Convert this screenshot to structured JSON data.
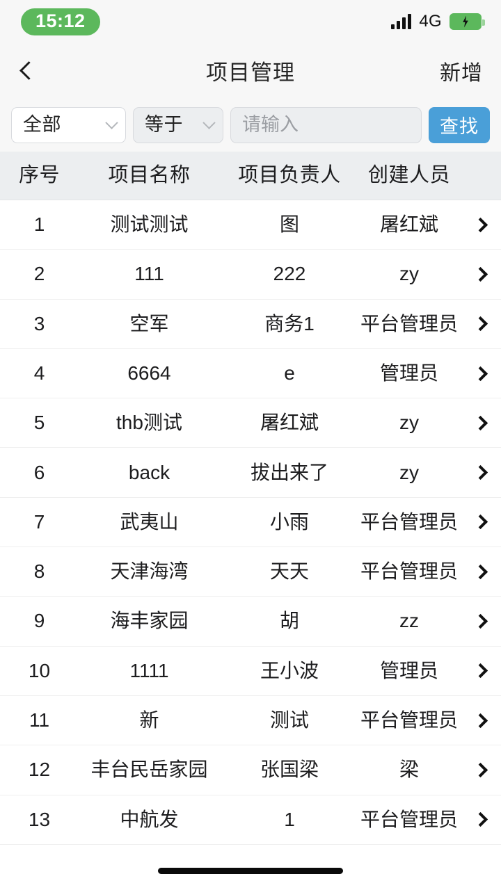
{
  "status_bar": {
    "time": "15:12",
    "network_label": "4G",
    "signal_icon": "signal-bars-icon",
    "battery_icon": "battery-charging-icon",
    "battery_color": "#5cb85c",
    "time_pill_color": "#5cb85c"
  },
  "nav_bar": {
    "back_icon": "chevron-left-icon",
    "title": "项目管理",
    "action_label": "新增"
  },
  "filter_bar": {
    "field_select": {
      "value": "全部",
      "icon": "chevron-down-icon"
    },
    "operator_select": {
      "value": "等于",
      "icon": "chevron-down-icon"
    },
    "keyword_input": {
      "value": "",
      "placeholder": "请输入"
    },
    "search_button": {
      "label": "查找",
      "color": "#4a9fd8"
    }
  },
  "table": {
    "columns": [
      "序号",
      "项目名称",
      "项目负责人",
      "创建人员"
    ],
    "row_arrow_icon": "chevron-right-icon",
    "rows": [
      {
        "index": "1",
        "name": "测试测试",
        "owner": "图",
        "creator": "屠红斌"
      },
      {
        "index": "2",
        "name": "111",
        "owner": "222",
        "creator": "zy"
      },
      {
        "index": "3",
        "name": "空军",
        "owner": "商务1",
        "creator": "平台管理员"
      },
      {
        "index": "4",
        "name": "6664",
        "owner": "e",
        "creator": "管理员"
      },
      {
        "index": "5",
        "name": "thb测试",
        "owner": "屠红斌",
        "creator": "zy"
      },
      {
        "index": "6",
        "name": "back",
        "owner": "拔出来了",
        "creator": "zy"
      },
      {
        "index": "7",
        "name": "武夷山",
        "owner": "小雨",
        "creator": "平台管理员"
      },
      {
        "index": "8",
        "name": "天津海湾",
        "owner": "天天",
        "creator": "平台管理员"
      },
      {
        "index": "9",
        "name": "海丰家园",
        "owner": "胡",
        "creator": "zz"
      },
      {
        "index": "10",
        "name": "1111",
        "owner": "王小波",
        "creator": "管理员"
      },
      {
        "index": "11",
        "name": "新",
        "owner": "测试",
        "creator": "平台管理员"
      },
      {
        "index": "12",
        "name": "丰台民岳家园",
        "owner": "张国梁",
        "creator": "梁"
      },
      {
        "index": "13",
        "name": "中航发",
        "owner": "1",
        "creator": "平台管理员"
      }
    ]
  },
  "home_indicator": {
    "icon": "home-indicator-bar"
  }
}
